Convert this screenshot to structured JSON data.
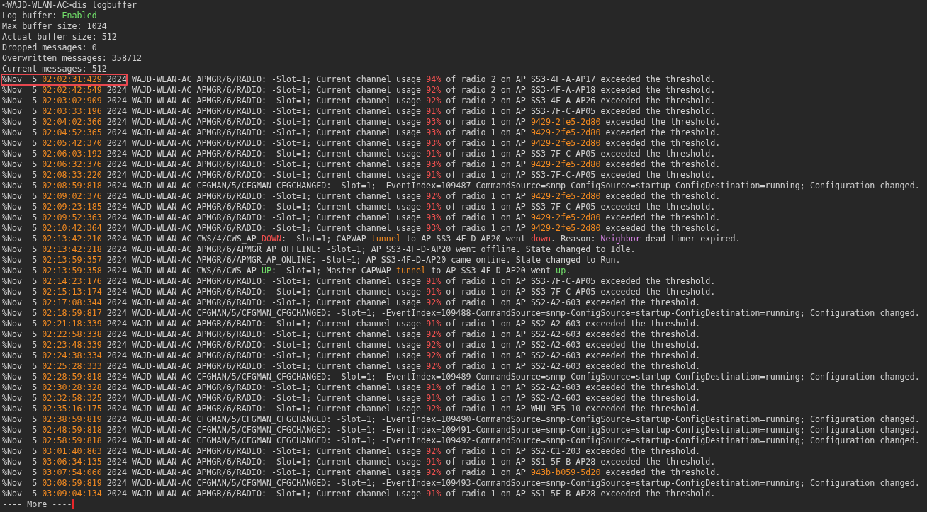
{
  "terminal": {
    "lines": [
      {
        "segments": [
          {
            "text": "<WAJD-WLAN-AC>dis logbuffer"
          }
        ]
      },
      {
        "segments": [
          {
            "text": "Log buffer: "
          },
          {
            "text": "Enabled",
            "kind": "good"
          }
        ]
      },
      {
        "segments": [
          {
            "text": "Max buffer size: 1024"
          }
        ]
      },
      {
        "segments": [
          {
            "text": "Actual buffer size: 512"
          }
        ]
      },
      {
        "segments": [
          {
            "text": "Dropped messages: 0"
          }
        ]
      },
      {
        "segments": [
          {
            "text": "Overwritten messages: 358712"
          }
        ]
      },
      {
        "segments": [
          {
            "text": "Current messages: 512"
          }
        ]
      },
      {
        "segments": [
          {
            "text": "%Nov  5 ",
            "boxed": true
          },
          {
            "text": "02:02:31:429",
            "kind": "accent",
            "boxed": true
          },
          {
            "text": " 2024",
            "boxed": true
          },
          {
            "text": " WAJD-WLAN-AC APMGR/6/RADIO: -Slot=1; Current channel usage "
          },
          {
            "text": "94%",
            "kind": "alert"
          },
          {
            "text": " of radio 2 on AP SS3-4F-A-AP17 exceeded the threshold."
          }
        ]
      },
      {
        "segments": [
          {
            "text": "%Nov  5 "
          },
          {
            "text": "02:02:42:549",
            "kind": "accent"
          },
          {
            "text": " 2024 WAJD-WLAN-AC APMGR/6/RADIO: -Slot=1; Current channel usage "
          },
          {
            "text": "92%",
            "kind": "alert"
          },
          {
            "text": " of radio 2 on AP SS3-4F-A-AP18 exceeded the threshold."
          }
        ]
      },
      {
        "segments": [
          {
            "text": "%Nov  5 "
          },
          {
            "text": "02:03:02:909",
            "kind": "accent"
          },
          {
            "text": " 2024 WAJD-WLAN-AC APMGR/6/RADIO: -Slot=1; Current channel usage "
          },
          {
            "text": "92%",
            "kind": "alert"
          },
          {
            "text": " of radio 2 on AP SS3-4F-A-AP26 exceeded the threshold."
          }
        ]
      },
      {
        "segments": [
          {
            "text": "%Nov  5 "
          },
          {
            "text": "02:03:33:196",
            "kind": "accent"
          },
          {
            "text": " 2024 WAJD-WLAN-AC APMGR/6/RADIO: -Slot=1; Current channel usage "
          },
          {
            "text": "91%",
            "kind": "alert"
          },
          {
            "text": " of radio 1 on AP SS3-7F-C-AP05 exceeded the threshold."
          }
        ]
      },
      {
        "segments": [
          {
            "text": "%Nov  5 "
          },
          {
            "text": "02:04:02:366",
            "kind": "accent"
          },
          {
            "text": " 2024 WAJD-WLAN-AC APMGR/6/RADIO: -Slot=1; Current channel usage "
          },
          {
            "text": "93%",
            "kind": "alert"
          },
          {
            "text": " of radio 1 on AP "
          },
          {
            "text": "9429-2fe5-2d80",
            "kind": "accent"
          },
          {
            "text": " exceeded the threshold."
          }
        ]
      },
      {
        "segments": [
          {
            "text": "%Nov  5 "
          },
          {
            "text": "02:04:52:365",
            "kind": "accent"
          },
          {
            "text": " 2024 WAJD-WLAN-AC APMGR/6/RADIO: -Slot=1; Current channel usage "
          },
          {
            "text": "93%",
            "kind": "alert"
          },
          {
            "text": " of radio 1 on AP "
          },
          {
            "text": "9429-2fe5-2d80",
            "kind": "accent"
          },
          {
            "text": " exceeded the threshold."
          }
        ]
      },
      {
        "segments": [
          {
            "text": "%Nov  5 "
          },
          {
            "text": "02:05:42:370",
            "kind": "accent"
          },
          {
            "text": " 2024 WAJD-WLAN-AC APMGR/6/RADIO: -Slot=1; Current channel usage "
          },
          {
            "text": "93%",
            "kind": "alert"
          },
          {
            "text": " of radio 1 on AP "
          },
          {
            "text": "9429-2fe5-2d80",
            "kind": "accent"
          },
          {
            "text": " exceeded the threshold."
          }
        ]
      },
      {
        "segments": [
          {
            "text": "%Nov  5 "
          },
          {
            "text": "02:06:03:192",
            "kind": "accent"
          },
          {
            "text": " 2024 WAJD-WLAN-AC APMGR/6/RADIO: -Slot=1; Current channel usage "
          },
          {
            "text": "91%",
            "kind": "alert"
          },
          {
            "text": " of radio 1 on AP SS3-7F-C-AP05 exceeded the threshold."
          }
        ]
      },
      {
        "segments": [
          {
            "text": "%Nov  5 "
          },
          {
            "text": "02:06:32:376",
            "kind": "accent"
          },
          {
            "text": " 2024 WAJD-WLAN-AC APMGR/6/RADIO: -Slot=1; Current channel usage "
          },
          {
            "text": "93%",
            "kind": "alert"
          },
          {
            "text": " of radio 1 on AP "
          },
          {
            "text": "9429-2fe5-2d80",
            "kind": "accent"
          },
          {
            "text": " exceeded the threshold."
          }
        ]
      },
      {
        "segments": [
          {
            "text": "%Nov  5 "
          },
          {
            "text": "02:08:33:220",
            "kind": "accent"
          },
          {
            "text": " 2024 WAJD-WLAN-AC APMGR/6/RADIO: -Slot=1; Current channel usage "
          },
          {
            "text": "91%",
            "kind": "alert"
          },
          {
            "text": " of radio 1 on AP SS3-7F-C-AP05 exceeded the threshold."
          }
        ]
      },
      {
        "segments": [
          {
            "text": "%Nov  5 "
          },
          {
            "text": "02:08:59:818",
            "kind": "accent"
          },
          {
            "text": " 2024 WAJD-WLAN-AC CFGMAN/5/CFGMAN_CFGCHANGED: -Slot=1; -EventIndex=109487-CommandSource=snmp-ConfigSource=startup-ConfigDestination=running; Configuration changed."
          }
        ]
      },
      {
        "segments": [
          {
            "text": "%Nov  5 "
          },
          {
            "text": "02:09:02:376",
            "kind": "accent"
          },
          {
            "text": " 2024 WAJD-WLAN-AC APMGR/6/RADIO: -Slot=1; Current channel usage "
          },
          {
            "text": "92%",
            "kind": "alert"
          },
          {
            "text": " of radio 1 on AP "
          },
          {
            "text": "9429-2fe5-2d80",
            "kind": "accent"
          },
          {
            "text": " exceeded the threshold."
          }
        ]
      },
      {
        "segments": [
          {
            "text": "%Nov  5 "
          },
          {
            "text": "02:09:23:185",
            "kind": "accent"
          },
          {
            "text": " 2024 WAJD-WLAN-AC APMGR/6/RADIO: -Slot=1; Current channel usage "
          },
          {
            "text": "91%",
            "kind": "alert"
          },
          {
            "text": " of radio 1 on AP SS3-7F-C-AP05 exceeded the threshold."
          }
        ]
      },
      {
        "segments": [
          {
            "text": "%Nov  5 "
          },
          {
            "text": "02:09:52:363",
            "kind": "accent"
          },
          {
            "text": " 2024 WAJD-WLAN-AC APMGR/6/RADIO: -Slot=1; Current channel usage "
          },
          {
            "text": "93%",
            "kind": "alert"
          },
          {
            "text": " of radio 1 on AP "
          },
          {
            "text": "9429-2fe5-2d80",
            "kind": "accent"
          },
          {
            "text": " exceeded the threshold."
          }
        ]
      },
      {
        "segments": [
          {
            "text": "%Nov  5 "
          },
          {
            "text": "02:10:42:364",
            "kind": "accent"
          },
          {
            "text": " 2024 WAJD-WLAN-AC APMGR/6/RADIO: -Slot=1; Current channel usage "
          },
          {
            "text": "93%",
            "kind": "alert"
          },
          {
            "text": " of radio 1 on AP "
          },
          {
            "text": "9429-2fe5-2d80",
            "kind": "accent"
          },
          {
            "text": " exceeded the threshold."
          }
        ]
      },
      {
        "segments": [
          {
            "text": "%Nov  5 "
          },
          {
            "text": "02:13:42:210",
            "kind": "accent"
          },
          {
            "text": " 2024 WAJD-WLAN-AC CWS/4/CWS_AP_"
          },
          {
            "text": "DOWN",
            "kind": "alert"
          },
          {
            "text": ": -Slot=1; CAPWAP "
          },
          {
            "text": "tunnel",
            "kind": "accent"
          },
          {
            "text": " to AP SS3-4F-D-AP20 went "
          },
          {
            "text": "down",
            "kind": "alert"
          },
          {
            "text": ". Reason: "
          },
          {
            "text": "Neighbor",
            "kind": "keyword"
          },
          {
            "text": " dead timer expired."
          }
        ]
      },
      {
        "segments": [
          {
            "text": "%Nov  5 "
          },
          {
            "text": "02:13:42:218",
            "kind": "accent"
          },
          {
            "text": " 2024 WAJD-WLAN-AC APMGR/6/APMGR_AP_OFFLINE: -Slot=1; AP SS3-4F-D-AP20 went offline. State changed to Idle."
          }
        ]
      },
      {
        "segments": [
          {
            "text": "%Nov  5 "
          },
          {
            "text": "02:13:59:357",
            "kind": "accent"
          },
          {
            "text": " 2024 WAJD-WLAN-AC APMGR/6/APMGR_AP_ONLINE: -Slot=1; AP SS3-4F-D-AP20 came online. State changed to Run."
          }
        ]
      },
      {
        "segments": [
          {
            "text": "%Nov  5 "
          },
          {
            "text": "02:13:59:358",
            "kind": "accent"
          },
          {
            "text": " 2024 WAJD-WLAN-AC CWS/6/CWS_AP_"
          },
          {
            "text": "UP",
            "kind": "good"
          },
          {
            "text": ": -Slot=1; Master CAPWAP "
          },
          {
            "text": "tunnel",
            "kind": "accent"
          },
          {
            "text": " to AP SS3-4F-D-AP20 went "
          },
          {
            "text": "up",
            "kind": "good"
          },
          {
            "text": "."
          }
        ]
      },
      {
        "segments": [
          {
            "text": "%Nov  5 "
          },
          {
            "text": "02:14:23:176",
            "kind": "accent"
          },
          {
            "text": " 2024 WAJD-WLAN-AC APMGR/6/RADIO: -Slot=1; Current channel usage "
          },
          {
            "text": "91%",
            "kind": "alert"
          },
          {
            "text": " of radio 1 on AP SS3-7F-C-AP05 exceeded the threshold."
          }
        ]
      },
      {
        "segments": [
          {
            "text": "%Nov  5 "
          },
          {
            "text": "02:15:13:174",
            "kind": "accent"
          },
          {
            "text": " 2024 WAJD-WLAN-AC APMGR/6/RADIO: -Slot=1; Current channel usage "
          },
          {
            "text": "91%",
            "kind": "alert"
          },
          {
            "text": " of radio 1 on AP SS3-7F-C-AP05 exceeded the threshold."
          }
        ]
      },
      {
        "segments": [
          {
            "text": "%Nov  5 "
          },
          {
            "text": "02:17:08:344",
            "kind": "accent"
          },
          {
            "text": " 2024 WAJD-WLAN-AC APMGR/6/RADIO: -Slot=1; Current channel usage "
          },
          {
            "text": "92%",
            "kind": "alert"
          },
          {
            "text": " of radio 1 on AP SS2-A2-603 exceeded the threshold."
          }
        ]
      },
      {
        "segments": [
          {
            "text": "%Nov  5 "
          },
          {
            "text": "02:18:59:817",
            "kind": "accent"
          },
          {
            "text": " 2024 WAJD-WLAN-AC CFGMAN/5/CFGMAN_CFGCHANGED: -Slot=1; -EventIndex=109488-CommandSource=snmp-ConfigSource=startup-ConfigDestination=running; Configuration changed."
          }
        ]
      },
      {
        "segments": [
          {
            "text": "%Nov  5 "
          },
          {
            "text": "02:21:18:339",
            "kind": "accent"
          },
          {
            "text": " 2024 WAJD-WLAN-AC APMGR/6/RADIO: -Slot=1; Current channel usage "
          },
          {
            "text": "91%",
            "kind": "alert"
          },
          {
            "text": " of radio 1 on AP SS2-A2-603 exceeded the threshold."
          }
        ]
      },
      {
        "segments": [
          {
            "text": "%Nov  5 "
          },
          {
            "text": "02:22:58:338",
            "kind": "accent"
          },
          {
            "text": " 2024 WAJD-WLAN-AC APMGR/6/RADIO: -Slot=1; Current channel usage "
          },
          {
            "text": "92%",
            "kind": "alert"
          },
          {
            "text": " of radio 1 on AP SS2-A2-603 exceeded the threshold."
          }
        ]
      },
      {
        "segments": [
          {
            "text": "%Nov  5 "
          },
          {
            "text": "02:23:48:339",
            "kind": "accent"
          },
          {
            "text": " 2024 WAJD-WLAN-AC APMGR/6/RADIO: -Slot=1; Current channel usage "
          },
          {
            "text": "92%",
            "kind": "alert"
          },
          {
            "text": " of radio 1 on AP SS2-A2-603 exceeded the threshold."
          }
        ]
      },
      {
        "segments": [
          {
            "text": "%Nov  5 "
          },
          {
            "text": "02:24:38:334",
            "kind": "accent"
          },
          {
            "text": " 2024 WAJD-WLAN-AC APMGR/6/RADIO: -Slot=1; Current channel usage "
          },
          {
            "text": "92%",
            "kind": "alert"
          },
          {
            "text": " of radio 1 on AP SS2-A2-603 exceeded the threshold."
          }
        ]
      },
      {
        "segments": [
          {
            "text": "%Nov  5 "
          },
          {
            "text": "02:25:28:333",
            "kind": "accent"
          },
          {
            "text": " 2024 WAJD-WLAN-AC APMGR/6/RADIO: -Slot=1; Current channel usage "
          },
          {
            "text": "92%",
            "kind": "alert"
          },
          {
            "text": " of radio 1 on AP SS2-A2-603 exceeded the threshold."
          }
        ]
      },
      {
        "segments": [
          {
            "text": "%Nov  5 "
          },
          {
            "text": "02:28:59:818",
            "kind": "accent"
          },
          {
            "text": " 2024 WAJD-WLAN-AC CFGMAN/5/CFGMAN_CFGCHANGED: -Slot=1; -EventIndex=109489-CommandSource=snmp-ConfigSource=startup-ConfigDestination=running; Configuration changed."
          }
        ]
      },
      {
        "segments": [
          {
            "text": "%Nov  5 "
          },
          {
            "text": "02:30:28:328",
            "kind": "accent"
          },
          {
            "text": " 2024 WAJD-WLAN-AC APMGR/6/RADIO: -Slot=1; Current channel usage "
          },
          {
            "text": "91%",
            "kind": "alert"
          },
          {
            "text": " of radio 1 on AP SS2-A2-603 exceeded the threshold."
          }
        ]
      },
      {
        "segments": [
          {
            "text": "%Nov  5 "
          },
          {
            "text": "02:32:58:325",
            "kind": "accent"
          },
          {
            "text": " 2024 WAJD-WLAN-AC APMGR/6/RADIO: -Slot=1; Current channel usage "
          },
          {
            "text": "91%",
            "kind": "alert"
          },
          {
            "text": " of radio 1 on AP SS2-A2-603 exceeded the threshold."
          }
        ]
      },
      {
        "segments": [
          {
            "text": "%Nov  5 "
          },
          {
            "text": "02:35:16:175",
            "kind": "accent"
          },
          {
            "text": " 2024 WAJD-WLAN-AC APMGR/6/RADIO: -Slot=1; Current channel usage "
          },
          {
            "text": "92%",
            "kind": "alert"
          },
          {
            "text": " of radio 1 on AP WHU-3F5-10 exceeded the threshold."
          }
        ]
      },
      {
        "segments": [
          {
            "text": "%Nov  5 "
          },
          {
            "text": "02:38:59:819",
            "kind": "accent"
          },
          {
            "text": " 2024 WAJD-WLAN-AC CFGMAN/5/CFGMAN_CFGCHANGED: -Slot=1; -EventIndex=109490-CommandSource=snmp-ConfigSource=startup-ConfigDestination=running; Configuration changed."
          }
        ]
      },
      {
        "segments": [
          {
            "text": "%Nov  5 "
          },
          {
            "text": "02:48:59:818",
            "kind": "accent"
          },
          {
            "text": " 2024 WAJD-WLAN-AC CFGMAN/5/CFGMAN_CFGCHANGED: -Slot=1; -EventIndex=109491-CommandSource=snmp-ConfigSource=startup-ConfigDestination=running; Configuration changed."
          }
        ]
      },
      {
        "segments": [
          {
            "text": "%Nov  5 "
          },
          {
            "text": "02:58:59:818",
            "kind": "accent"
          },
          {
            "text": " 2024 WAJD-WLAN-AC CFGMAN/5/CFGMAN_CFGCHANGED: -Slot=1; -EventIndex=109492-CommandSource=snmp-ConfigSource=startup-ConfigDestination=running; Configuration changed."
          }
        ]
      },
      {
        "segments": [
          {
            "text": "%Nov  5 "
          },
          {
            "text": "03:01:40:863",
            "kind": "accent"
          },
          {
            "text": " 2024 WAJD-WLAN-AC APMGR/6/RADIO: -Slot=1; Current channel usage "
          },
          {
            "text": "92%",
            "kind": "alert"
          },
          {
            "text": " of radio 1 on AP SS2-C1-203 exceeded the threshold."
          }
        ]
      },
      {
        "segments": [
          {
            "text": "%Nov  5 "
          },
          {
            "text": "03:06:34:135",
            "kind": "accent"
          },
          {
            "text": " 2024 WAJD-WLAN-AC APMGR/6/RADIO: -Slot=1; Current channel usage "
          },
          {
            "text": "91%",
            "kind": "alert"
          },
          {
            "text": " of radio 1 on AP SS1-5F-B-AP28 exceeded the threshold."
          }
        ]
      },
      {
        "segments": [
          {
            "text": "%Nov  5 "
          },
          {
            "text": "03:07:54:060",
            "kind": "accent"
          },
          {
            "text": " 2024 WAJD-WLAN-AC APMGR/6/RADIO: -Slot=1; Current channel usage "
          },
          {
            "text": "92%",
            "kind": "alert"
          },
          {
            "text": " of radio 1 on AP "
          },
          {
            "text": "943b-b059-5d20",
            "kind": "accent"
          },
          {
            "text": " exceeded the threshold."
          }
        ]
      },
      {
        "segments": [
          {
            "text": "%Nov  5 "
          },
          {
            "text": "03:08:59:819",
            "kind": "accent"
          },
          {
            "text": " 2024 WAJD-WLAN-AC CFGMAN/5/CFGMAN_CFGCHANGED: -Slot=1; -EventIndex=109493-CommandSource=snmp-ConfigSource=startup-ConfigDestination=running; Configuration changed."
          }
        ]
      },
      {
        "segments": [
          {
            "text": "%Nov  5 "
          },
          {
            "text": "03:09:04:134",
            "kind": "accent"
          },
          {
            "text": " 2024 WAJD-WLAN-AC APMGR/6/RADIO: -Slot=1; Current channel usage "
          },
          {
            "text": "91%",
            "kind": "alert"
          },
          {
            "text": " of radio 1 on AP SS1-5F-B-AP28 exceeded the threshold."
          }
        ]
      },
      {
        "segments": [
          {
            "text": "---- More ----"
          }
        ],
        "cursor": true
      }
    ]
  }
}
